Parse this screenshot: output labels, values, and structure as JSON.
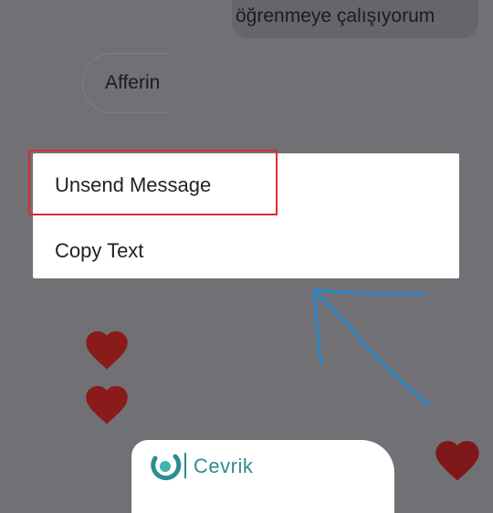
{
  "messages": {
    "sent_text": "öğrenmeye çalışıyorum",
    "received_text": "Afferin"
  },
  "context_menu": {
    "items": [
      {
        "label": "Unsend Message"
      },
      {
        "label": "Copy Text"
      }
    ]
  },
  "watermark": {
    "brand": "Cevrik"
  },
  "colors": {
    "overlay": "#717075",
    "highlight": "#d62f2f",
    "arrow": "#2a86c7",
    "heart": "#8b1a1a",
    "brand": "#2c8d8f"
  },
  "icons": [
    "heart-icon",
    "annotation-arrow",
    "cevrik-logo-icon"
  ]
}
